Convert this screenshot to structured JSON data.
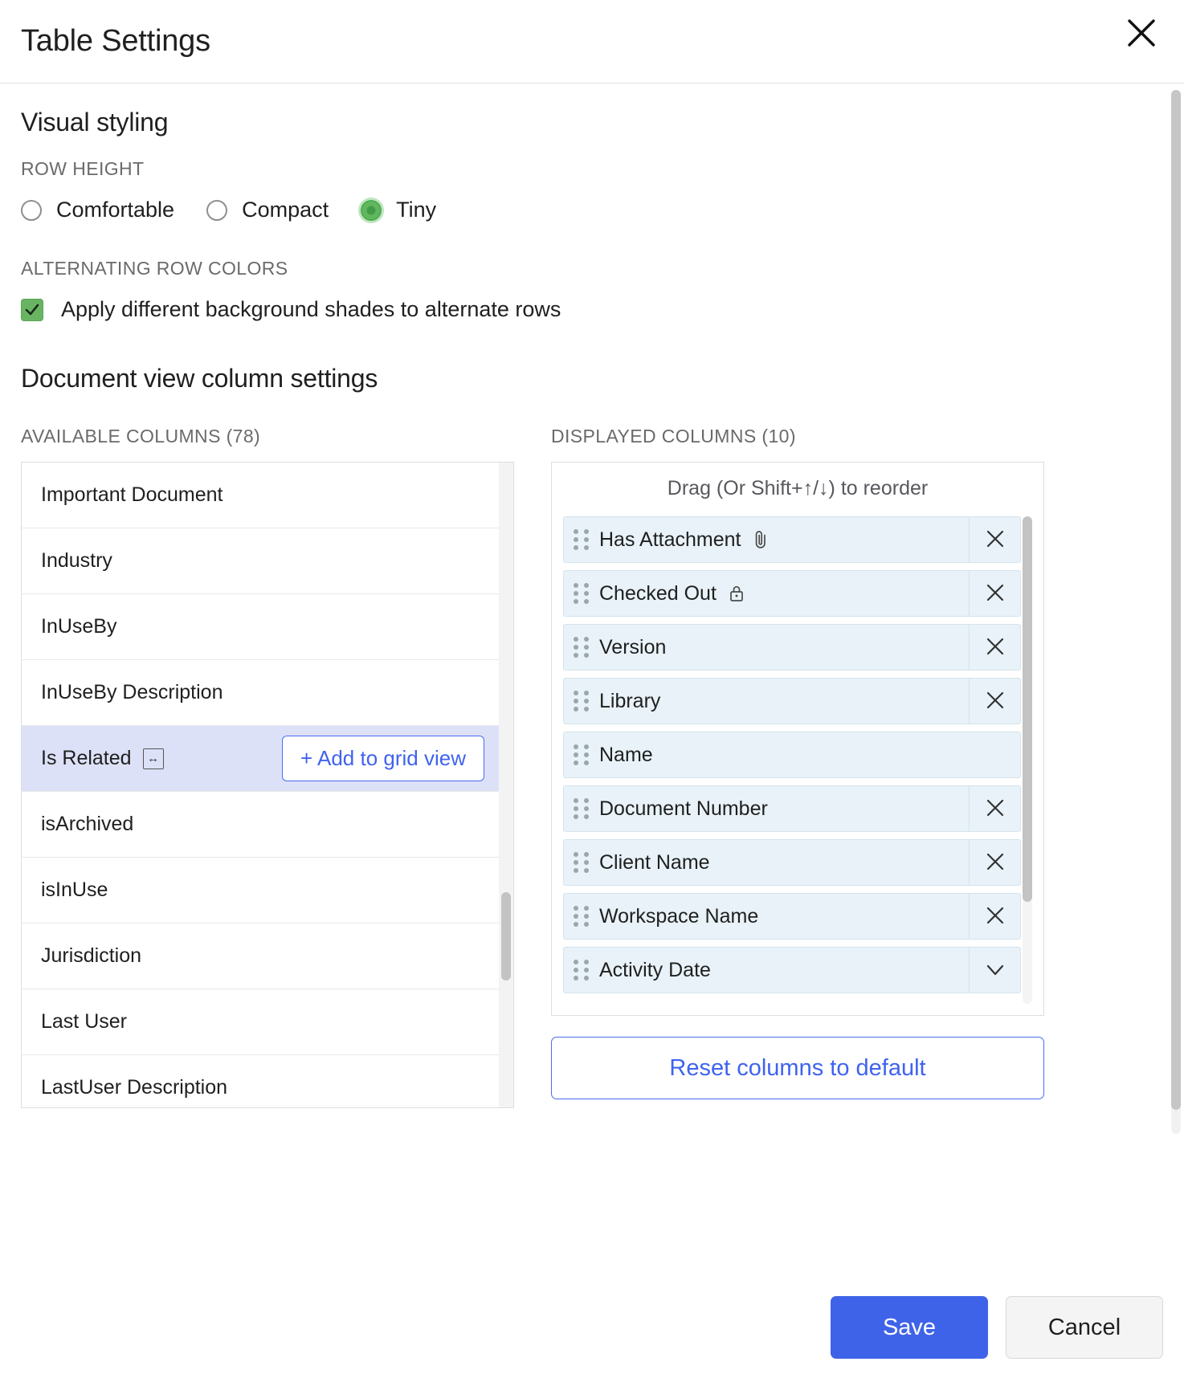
{
  "header": {
    "title": "Table Settings",
    "close_icon": "close-icon"
  },
  "visual_styling": {
    "section_title": "Visual styling",
    "row_height": {
      "label": "ROW HEIGHT",
      "options": [
        {
          "label": "Comfortable",
          "selected": false
        },
        {
          "label": "Compact",
          "selected": false
        },
        {
          "label": "Tiny",
          "selected": true
        }
      ]
    },
    "alternating_rows": {
      "label": "ALTERNATING ROW COLORS",
      "checkbox_label": "Apply different background shades to alternate rows",
      "checked": true
    }
  },
  "column_settings": {
    "section_title": "Document view column settings",
    "available": {
      "label": "AVAILABLE COLUMNS (78)",
      "count": 78,
      "items": [
        {
          "label": "Important Document",
          "highlight": false,
          "icon": null,
          "action": null
        },
        {
          "label": "Industry",
          "highlight": false,
          "icon": null,
          "action": null
        },
        {
          "label": "InUseBy",
          "highlight": false,
          "icon": null,
          "action": null
        },
        {
          "label": "InUseBy Description",
          "highlight": false,
          "icon": null,
          "action": null
        },
        {
          "label": "Is Related",
          "highlight": true,
          "icon": "resize-horizontal-icon",
          "action": "+ Add to grid view"
        },
        {
          "label": "isArchived",
          "highlight": false,
          "icon": null,
          "action": null
        },
        {
          "label": "isInUse",
          "highlight": false,
          "icon": null,
          "action": null
        },
        {
          "label": "Jurisdiction",
          "highlight": false,
          "icon": null,
          "action": null
        },
        {
          "label": "Last User",
          "highlight": false,
          "icon": null,
          "action": null
        },
        {
          "label": "LastUser Description",
          "highlight": false,
          "icon": null,
          "action": null
        }
      ]
    },
    "displayed": {
      "label": "DISPLAYED COLUMNS (10)",
      "count": 10,
      "drag_hint": "Drag (Or Shift+↑/↓) to reorder",
      "items": [
        {
          "label": "Has Attachment",
          "icon": "paperclip-icon",
          "removable": true
        },
        {
          "label": "Checked Out",
          "icon": "lock-icon",
          "removable": true
        },
        {
          "label": "Version",
          "icon": null,
          "removable": true
        },
        {
          "label": "Library",
          "icon": null,
          "removable": true
        },
        {
          "label": "Name",
          "icon": null,
          "removable": false
        },
        {
          "label": "Document Number",
          "icon": null,
          "removable": true
        },
        {
          "label": "Client Name",
          "icon": null,
          "removable": true
        },
        {
          "label": "Workspace Name",
          "icon": null,
          "removable": true
        },
        {
          "label": "Activity Date",
          "icon": null,
          "removable": true
        }
      ]
    },
    "reset_label": "Reset columns to default"
  },
  "footer": {
    "save_label": "Save",
    "cancel_label": "Cancel"
  },
  "colors": {
    "accent_blue": "#3f63e8",
    "link_blue": "#3f63ef",
    "selected_green": "#62b65f",
    "highlight_row": "#dde1f7",
    "chip_bg": "#e8f2f8"
  }
}
